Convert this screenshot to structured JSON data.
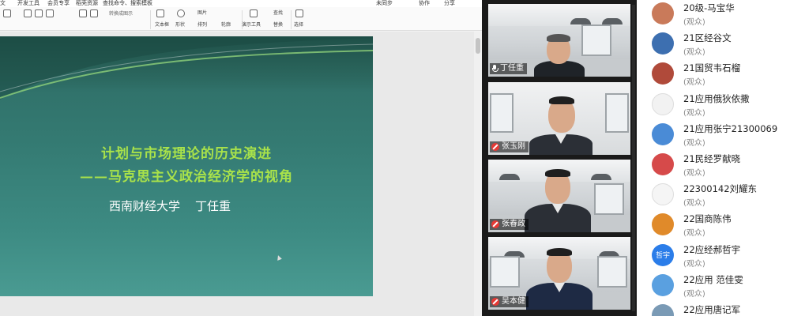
{
  "menubar": {
    "items": [
      "文",
      "开发工具",
      "会员专享",
      "稻壳资源",
      "查找命令、搜索模板"
    ],
    "right_items": [
      "未同步",
      "协作",
      "分享"
    ]
  },
  "ribbon": {
    "groups": [
      {
        "label": "文本框"
      },
      {
        "label": "形状"
      },
      {
        "label": "排列"
      },
      {
        "label": "轮廓"
      },
      {
        "label": "演示工具"
      },
      {
        "label": "替换"
      },
      {
        "label": "选择"
      }
    ],
    "small_items": [
      "图片",
      "查找",
      "转换成图示"
    ]
  },
  "slide": {
    "title_line1": "计划与市场理论的历史演进",
    "title_line2": "——马克思主义政治经济学的视角",
    "author": "西南财经大学    丁任重"
  },
  "video_tiles": [
    {
      "name": "丁任重",
      "mic": "on"
    },
    {
      "name": "张玉刚",
      "mic": "off"
    },
    {
      "name": "张春政",
      "mic": "off"
    },
    {
      "name": "吴本健",
      "mic": "off"
    }
  ],
  "participants": [
    {
      "name": "20级-马宝华",
      "role": "(观众)",
      "avatar_color": "#c97a5a",
      "avatar_text": ""
    },
    {
      "name": "21区经谷文",
      "role": "(观众)",
      "avatar_color": "#3d6fb0",
      "avatar_text": ""
    },
    {
      "name": "21国贸韦石榴",
      "role": "(观众)",
      "avatar_color": "#b04a3a",
      "avatar_text": ""
    },
    {
      "name": "21应用俄狄依撒",
      "role": "(观众)",
      "avatar_color": "#f2f2f2",
      "avatar_text": ""
    },
    {
      "name": "21应用张宁21300069",
      "role": "(观众)",
      "avatar_color": "#4a8bd6",
      "avatar_text": ""
    },
    {
      "name": "21民经罗献晓",
      "role": "(观众)",
      "avatar_color": "#d64a4a",
      "avatar_text": ""
    },
    {
      "name": "22300142刘耀东",
      "role": "(观众)",
      "avatar_color": "#f5f5f5",
      "avatar_text": ""
    },
    {
      "name": "22国商陈伟",
      "role": "(观众)",
      "avatar_color": "#e08a2a",
      "avatar_text": ""
    },
    {
      "name": "22应经郝哲宇",
      "role": "(观众)",
      "avatar_color": "#2b7de9",
      "avatar_text": "哲宇"
    },
    {
      "name": "22应用 范佳雯",
      "role": "(观众)",
      "avatar_color": "#5aa0e0",
      "avatar_text": ""
    },
    {
      "name": "22应用唐记军",
      "role": "",
      "avatar_color": "#7a9ab5",
      "avatar_text": ""
    }
  ]
}
